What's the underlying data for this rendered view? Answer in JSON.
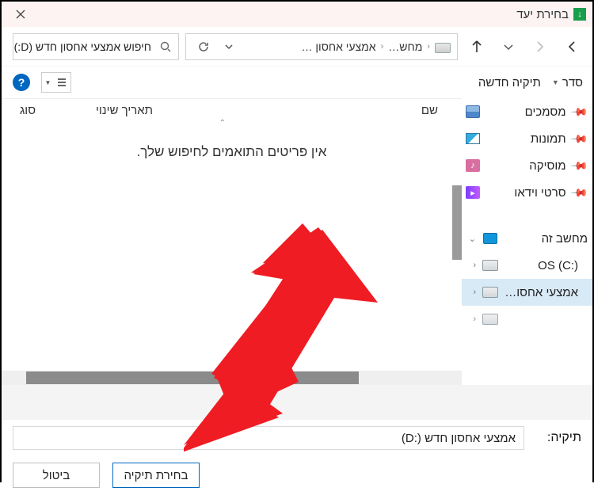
{
  "window": {
    "title": "בחירת יעד"
  },
  "nav": {
    "crumb1": "מחש…",
    "crumb2": "אמצעי אחסון …"
  },
  "search": {
    "value": "חיפוש אמצעי אחסון חדש (D:)"
  },
  "commands": {
    "organize": "סדר",
    "new_folder": "תיקיה חדשה",
    "help": "?"
  },
  "columns": {
    "name": "שם",
    "date": "תאריך שינוי",
    "type": "סוג"
  },
  "content": {
    "empty": "אין פריטים התואמים לחיפוש שלך."
  },
  "sidebar": {
    "documents": "מסמכים",
    "pictures": "תמונות",
    "music": "מוסיקה",
    "videos": "סרטי וידאו",
    "this_pc": "מחשב זה",
    "os_c": "OS (C:)",
    "new_vol_d": "אמצעי אחסון ח"
  },
  "footer": {
    "folder_label": "תיקיה:",
    "folder_value": "(D:) אמצעי אחסון חדש",
    "select": "בחירת תיקיה",
    "cancel": "ביטול"
  }
}
